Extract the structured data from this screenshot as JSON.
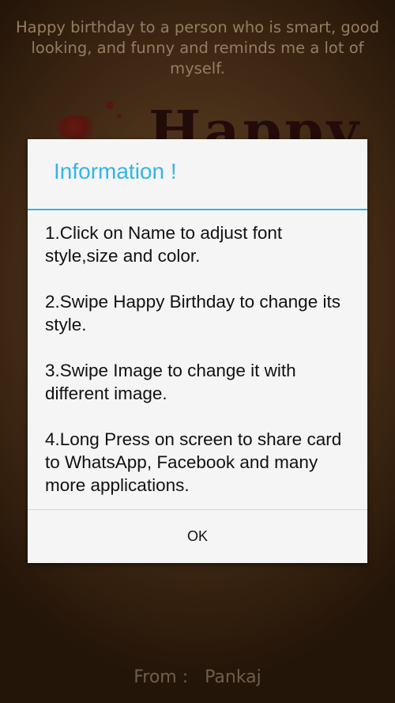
{
  "card": {
    "greeting": "Happy birthday to a person who is smart, good looking, and funny and reminds me a lot of myself.",
    "title_art": "Happy",
    "from_label": "From :",
    "from_name": "Pankaj"
  },
  "dialog": {
    "title": "Information !",
    "accent_color": "#33b5e5",
    "instructions": [
      "1.Click on Name to adjust font style,size and color.",
      "2.Swipe Happy Birthday to change its style.",
      "3.Swipe Image to change it with different image.",
      " 4.Long Press on screen to share card to WhatsApp, Facebook and many more applications."
    ],
    "ok_label": "OK"
  }
}
